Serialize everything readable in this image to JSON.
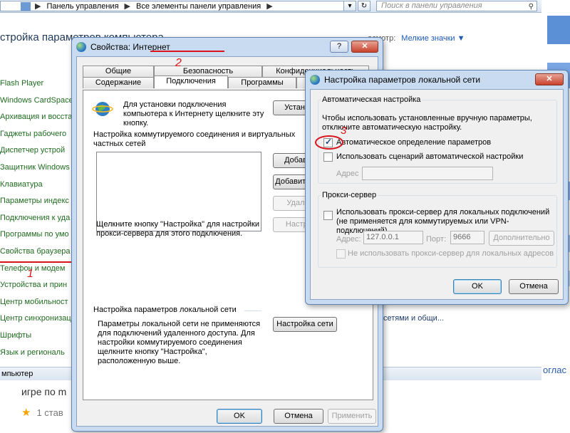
{
  "background": {
    "address_path": [
      "Панель управления",
      "Все элементы панели управления"
    ],
    "search_placeholder": "Поиск в панели управления",
    "title": "стройка параметров компьютера",
    "view_label": "осмотр:",
    "view_value": "Мелкие значки ▼",
    "items": [
      "Flash Player",
      "Windows CardSpace",
      "Архивация и восста",
      "Гаджеты рабочего",
      "Диспетчер устрой",
      "Защитник Windows",
      "Клавиатура",
      "Параметры индекс",
      "Подключения к уда",
      "Программы по умо",
      "Свойства браузера",
      "Телефон и модем",
      "Устройства и прин",
      "Центр мобильност",
      "Центр синхронизац",
      "Шрифты",
      "Язык и региональ"
    ],
    "right_text": "сетями и общи...",
    "status": "мпьютер",
    "below_text": "игре по m",
    "stars_text": "1 став",
    "right_link": "оглас",
    "annotation1": "1"
  },
  "ip": {
    "title": "Свойства: Интернет",
    "help_btn": "?",
    "close_btn": "✕",
    "tabs_top": [
      "Общие",
      "Безопасность",
      "Конфиденциальность"
    ],
    "tabs_bottom": [
      "Содержание",
      "Подключения",
      "Программы"
    ],
    "annotation2": "2",
    "setup_text": "Для установки подключения компьютера к Интернету щелкните эту кнопку.",
    "setup_btn": "Установить",
    "dialup_header": "Настройка коммутируемого соединения и виртуальных частных сетей",
    "add_btn": "Добавить...",
    "add_vpn_btn": "Добавить VPN...",
    "remove_btn": "Удалить...",
    "settings_btn": "Настройка",
    "settings_hint": "Щелкните кнопку \"Настройка\" для настройки прокси-сервера для этого подключения.",
    "lan_header": "Настройка параметров локальной сети",
    "lan_desc": "Параметры локальной сети не применяются для подключений удаленного доступа. Для настройки коммутируемого соединения щелкните кнопку \"Настройка\", расположенную выше.",
    "lan_btn": "Настройка сети",
    "ok": "OK",
    "cancel": "Отмена",
    "apply": "Применить"
  },
  "lan": {
    "title": "Настройка параметров локальной сети",
    "close_btn": "✕",
    "auto_group": "Автоматическая настройка",
    "auto_desc": "Чтобы использовать установленные вручную параметры, отключите автоматическую настройку.",
    "auto_detect": "Автоматическое определение параметров",
    "auto_detect_checked": true,
    "use_script": "Использовать сценарий автоматической настройки",
    "address_label": "Адрес",
    "annotation3": "3",
    "proxy_group": "Прокси-сервер",
    "use_proxy": "Использовать прокси-сервер для локальных подключений (не применяется для коммутируемых или VPN-подключений).",
    "proxy_address_label": "Адрес:",
    "proxy_address": "127.0.0.1",
    "port_label": "Порт:",
    "port": "9666",
    "advanced_btn": "Дополнительно",
    "bypass_local": "Не использовать прокси-сервер для локальных адресов",
    "ok": "OK",
    "cancel": "Отмена"
  }
}
